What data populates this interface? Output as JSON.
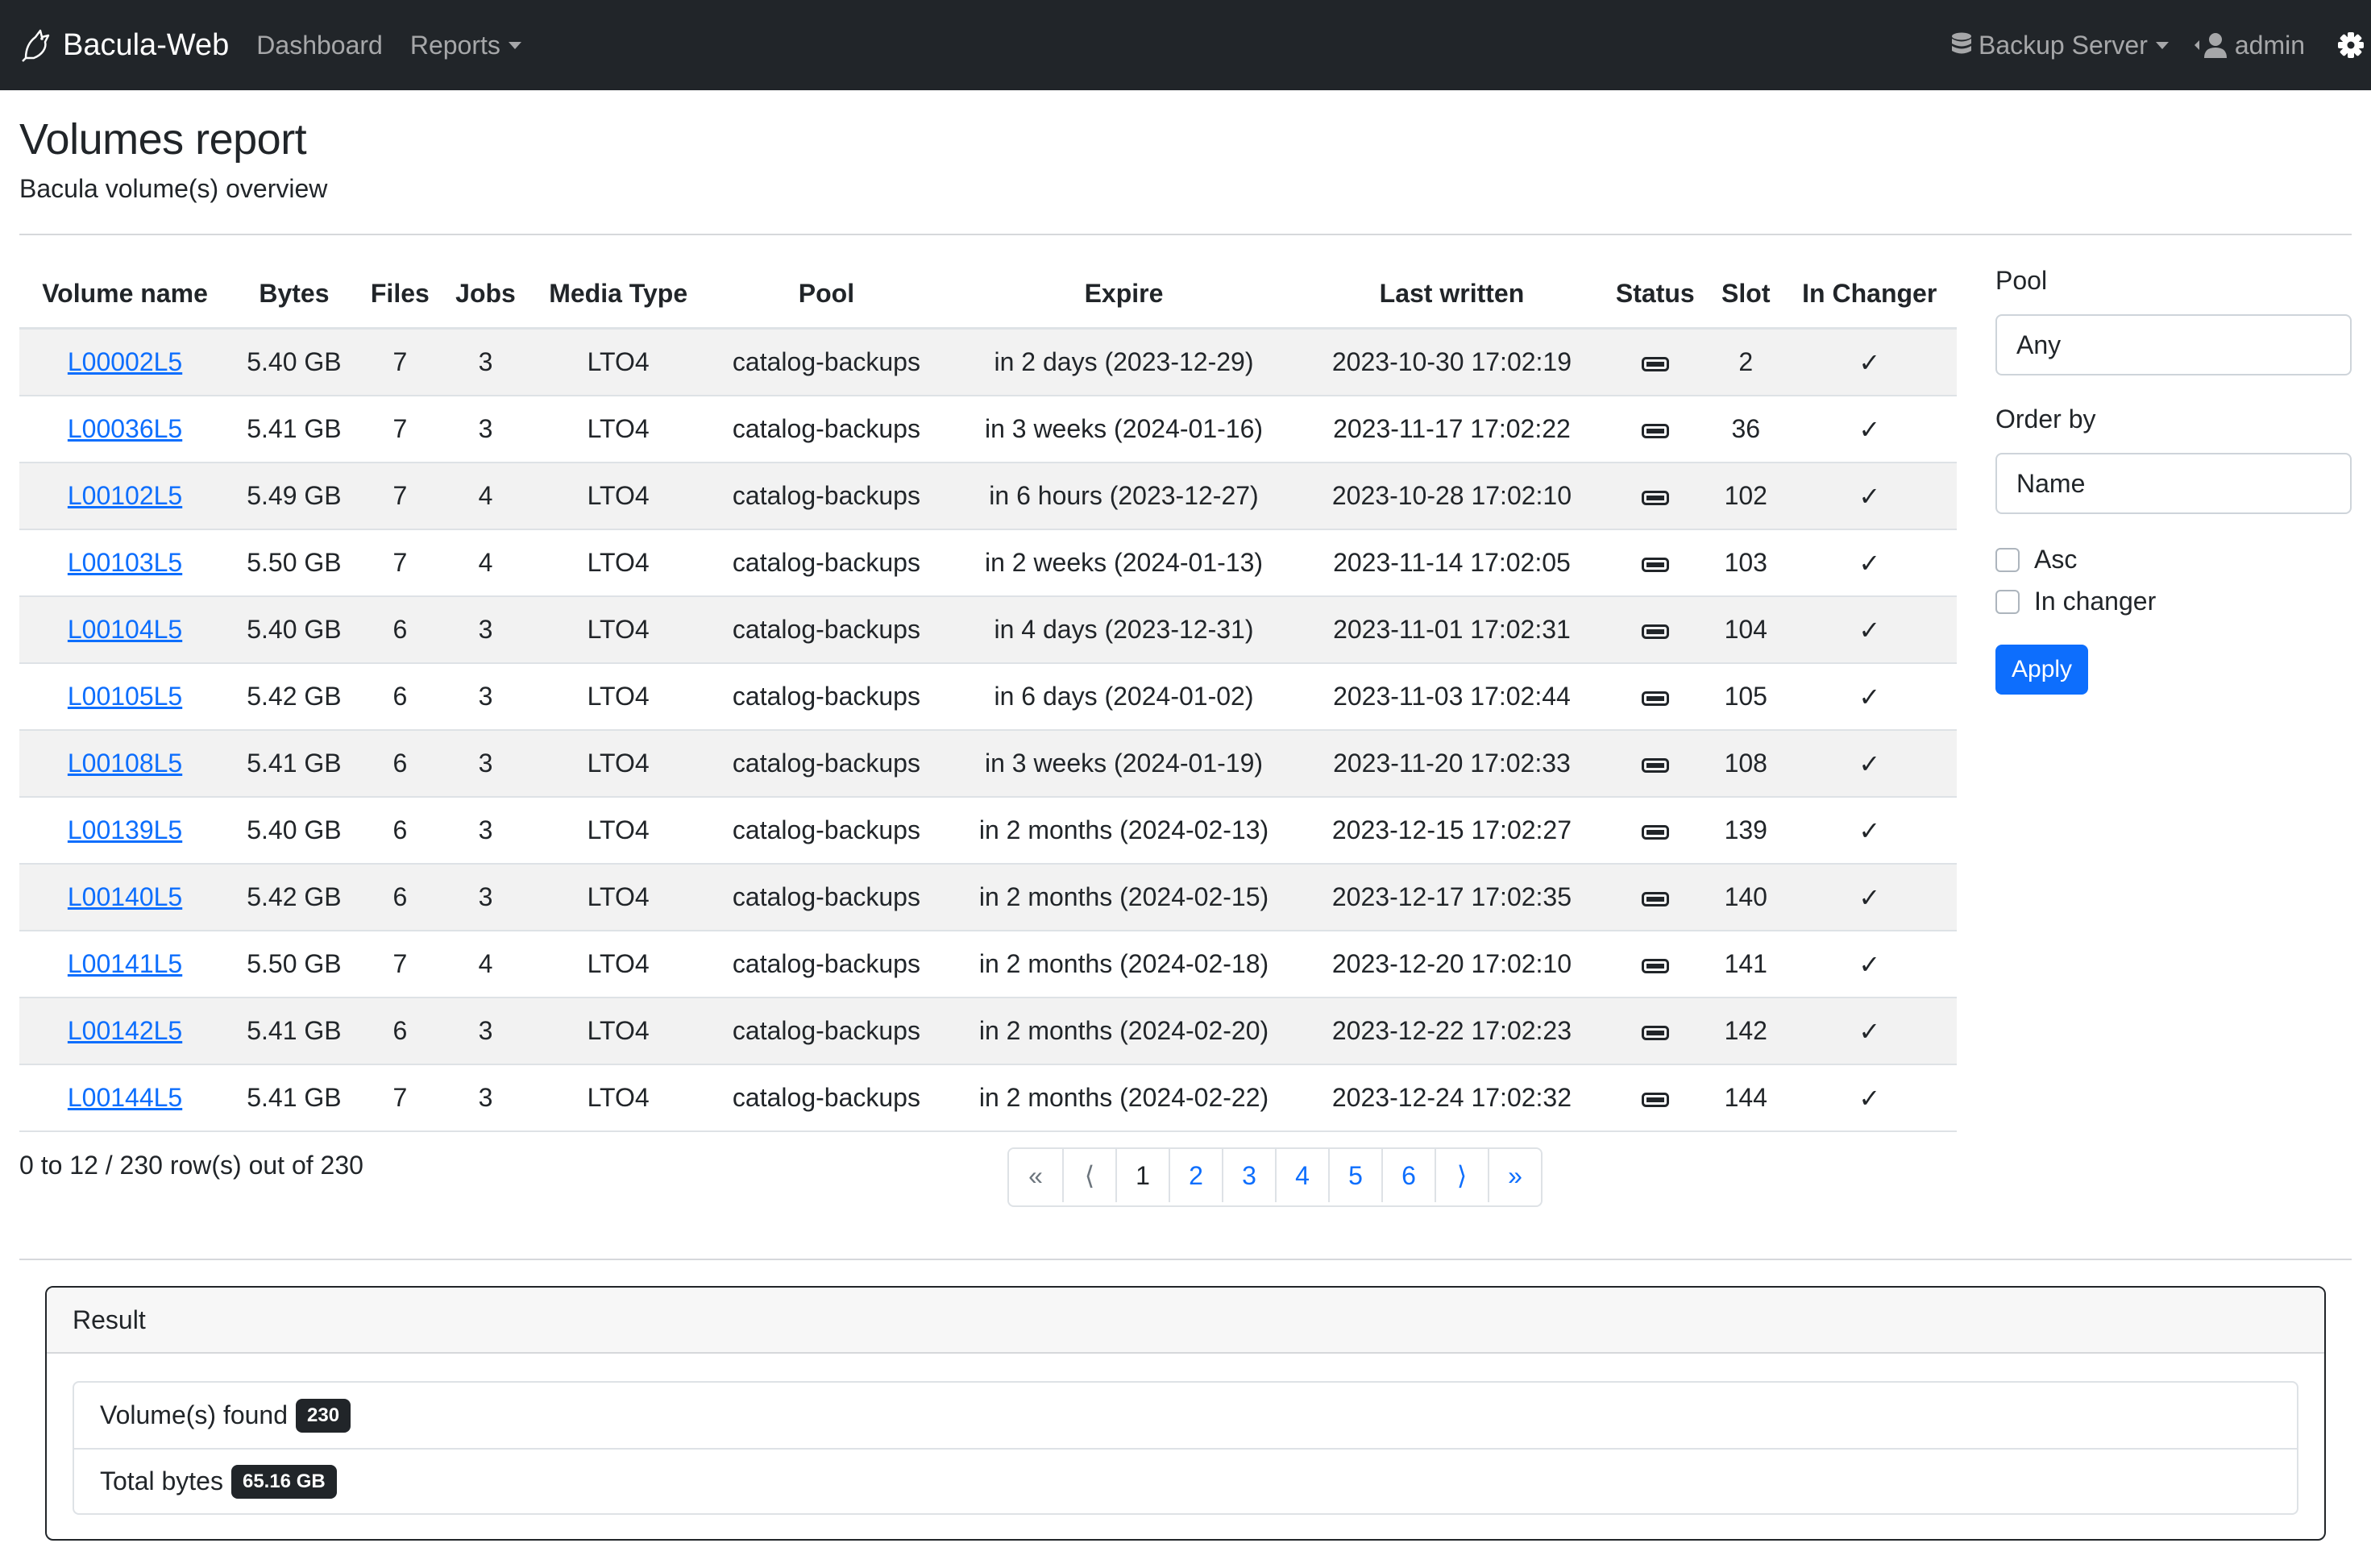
{
  "navbar": {
    "brand": "Bacula-Web",
    "dashboard": "Dashboard",
    "reports": "Reports",
    "server": "Backup Server",
    "user": "admin"
  },
  "header": {
    "title": "Volumes report",
    "subtitle": "Bacula volume(s) overview"
  },
  "table": {
    "columns": [
      "Volume name",
      "Bytes",
      "Files",
      "Jobs",
      "Media Type",
      "Pool",
      "Expire",
      "Last written",
      "Status",
      "Slot",
      "In Changer"
    ],
    "rows": [
      {
        "name": "L00002L5",
        "bytes": "5.40 GB",
        "files": "7",
        "jobs": "3",
        "media": "LTO4",
        "pool": "catalog-backups",
        "expire": "in 2 days (2023-12-29)",
        "last": "2023-10-30 17:02:19",
        "slot": "2",
        "changer": "✓"
      },
      {
        "name": "L00036L5",
        "bytes": "5.41 GB",
        "files": "7",
        "jobs": "3",
        "media": "LTO4",
        "pool": "catalog-backups",
        "expire": "in 3 weeks (2024-01-16)",
        "last": "2023-11-17 17:02:22",
        "slot": "36",
        "changer": "✓"
      },
      {
        "name": "L00102L5",
        "bytes": "5.49 GB",
        "files": "7",
        "jobs": "4",
        "media": "LTO4",
        "pool": "catalog-backups",
        "expire": "in 6 hours (2023-12-27)",
        "last": "2023-10-28 17:02:10",
        "slot": "102",
        "changer": "✓"
      },
      {
        "name": "L00103L5",
        "bytes": "5.50 GB",
        "files": "7",
        "jobs": "4",
        "media": "LTO4",
        "pool": "catalog-backups",
        "expire": "in 2 weeks (2024-01-13)",
        "last": "2023-11-14 17:02:05",
        "slot": "103",
        "changer": "✓"
      },
      {
        "name": "L00104L5",
        "bytes": "5.40 GB",
        "files": "6",
        "jobs": "3",
        "media": "LTO4",
        "pool": "catalog-backups",
        "expire": "in 4 days (2023-12-31)",
        "last": "2023-11-01 17:02:31",
        "slot": "104",
        "changer": "✓"
      },
      {
        "name": "L00105L5",
        "bytes": "5.42 GB",
        "files": "6",
        "jobs": "3",
        "media": "LTO4",
        "pool": "catalog-backups",
        "expire": "in 6 days (2024-01-02)",
        "last": "2023-11-03 17:02:44",
        "slot": "105",
        "changer": "✓"
      },
      {
        "name": "L00108L5",
        "bytes": "5.41 GB",
        "files": "6",
        "jobs": "3",
        "media": "LTO4",
        "pool": "catalog-backups",
        "expire": "in 3 weeks (2024-01-19)",
        "last": "2023-11-20 17:02:33",
        "slot": "108",
        "changer": "✓"
      },
      {
        "name": "L00139L5",
        "bytes": "5.40 GB",
        "files": "6",
        "jobs": "3",
        "media": "LTO4",
        "pool": "catalog-backups",
        "expire": "in 2 months (2024-02-13)",
        "last": "2023-12-15 17:02:27",
        "slot": "139",
        "changer": "✓"
      },
      {
        "name": "L00140L5",
        "bytes": "5.42 GB",
        "files": "6",
        "jobs": "3",
        "media": "LTO4",
        "pool": "catalog-backups",
        "expire": "in 2 months (2024-02-15)",
        "last": "2023-12-17 17:02:35",
        "slot": "140",
        "changer": "✓"
      },
      {
        "name": "L00141L5",
        "bytes": "5.50 GB",
        "files": "7",
        "jobs": "4",
        "media": "LTO4",
        "pool": "catalog-backups",
        "expire": "in 2 months (2024-02-18)",
        "last": "2023-12-20 17:02:10",
        "slot": "141",
        "changer": "✓"
      },
      {
        "name": "L00142L5",
        "bytes": "5.41 GB",
        "files": "6",
        "jobs": "3",
        "media": "LTO4",
        "pool": "catalog-backups",
        "expire": "in 2 months (2024-02-20)",
        "last": "2023-12-22 17:02:23",
        "slot": "142",
        "changer": "✓"
      },
      {
        "name": "L00144L5",
        "bytes": "5.41 GB",
        "files": "7",
        "jobs": "3",
        "media": "LTO4",
        "pool": "catalog-backups",
        "expire": "in 2 months (2024-02-22)",
        "last": "2023-12-24 17:02:32",
        "slot": "144",
        "changer": "✓"
      }
    ]
  },
  "rows_info": "0 to 12 / 230 row(s) out of 230",
  "pagination": {
    "first": "«",
    "prev": "⟨",
    "pages": [
      "1",
      "2",
      "3",
      "4",
      "5",
      "6"
    ],
    "next": "⟩",
    "last": "»"
  },
  "filters": {
    "pool_label": "Pool",
    "pool_value": "Any",
    "order_label": "Order by",
    "order_value": "Name",
    "asc_label": "Asc",
    "changer_label": "In changer",
    "apply_label": "Apply"
  },
  "result": {
    "title": "Result",
    "volumes_label": "Volume(s) found",
    "volumes_count": "230",
    "bytes_label": "Total bytes",
    "bytes_total": "65.16 GB"
  }
}
